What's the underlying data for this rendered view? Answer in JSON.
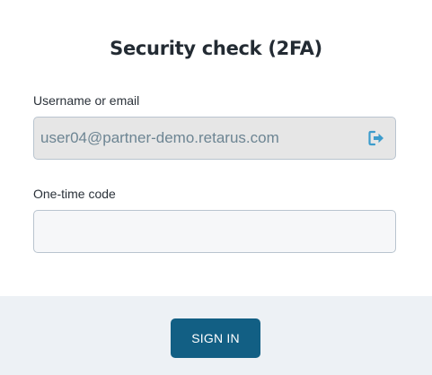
{
  "title": "Security check (2FA)",
  "username": {
    "label": "Username or email",
    "value": "user04@partner-demo.retarus.com",
    "icon": "logout-icon"
  },
  "otp": {
    "label": "One-time code",
    "value": "",
    "placeholder": ""
  },
  "actions": {
    "signin_label": "SIGN IN"
  },
  "colors": {
    "primary_button": "#125f84",
    "icon_accent": "#3d9ccc",
    "footer_background": "#edf1f5",
    "readonly_field_background": "#e6e6e6",
    "field_border": "#b9c4cf"
  }
}
